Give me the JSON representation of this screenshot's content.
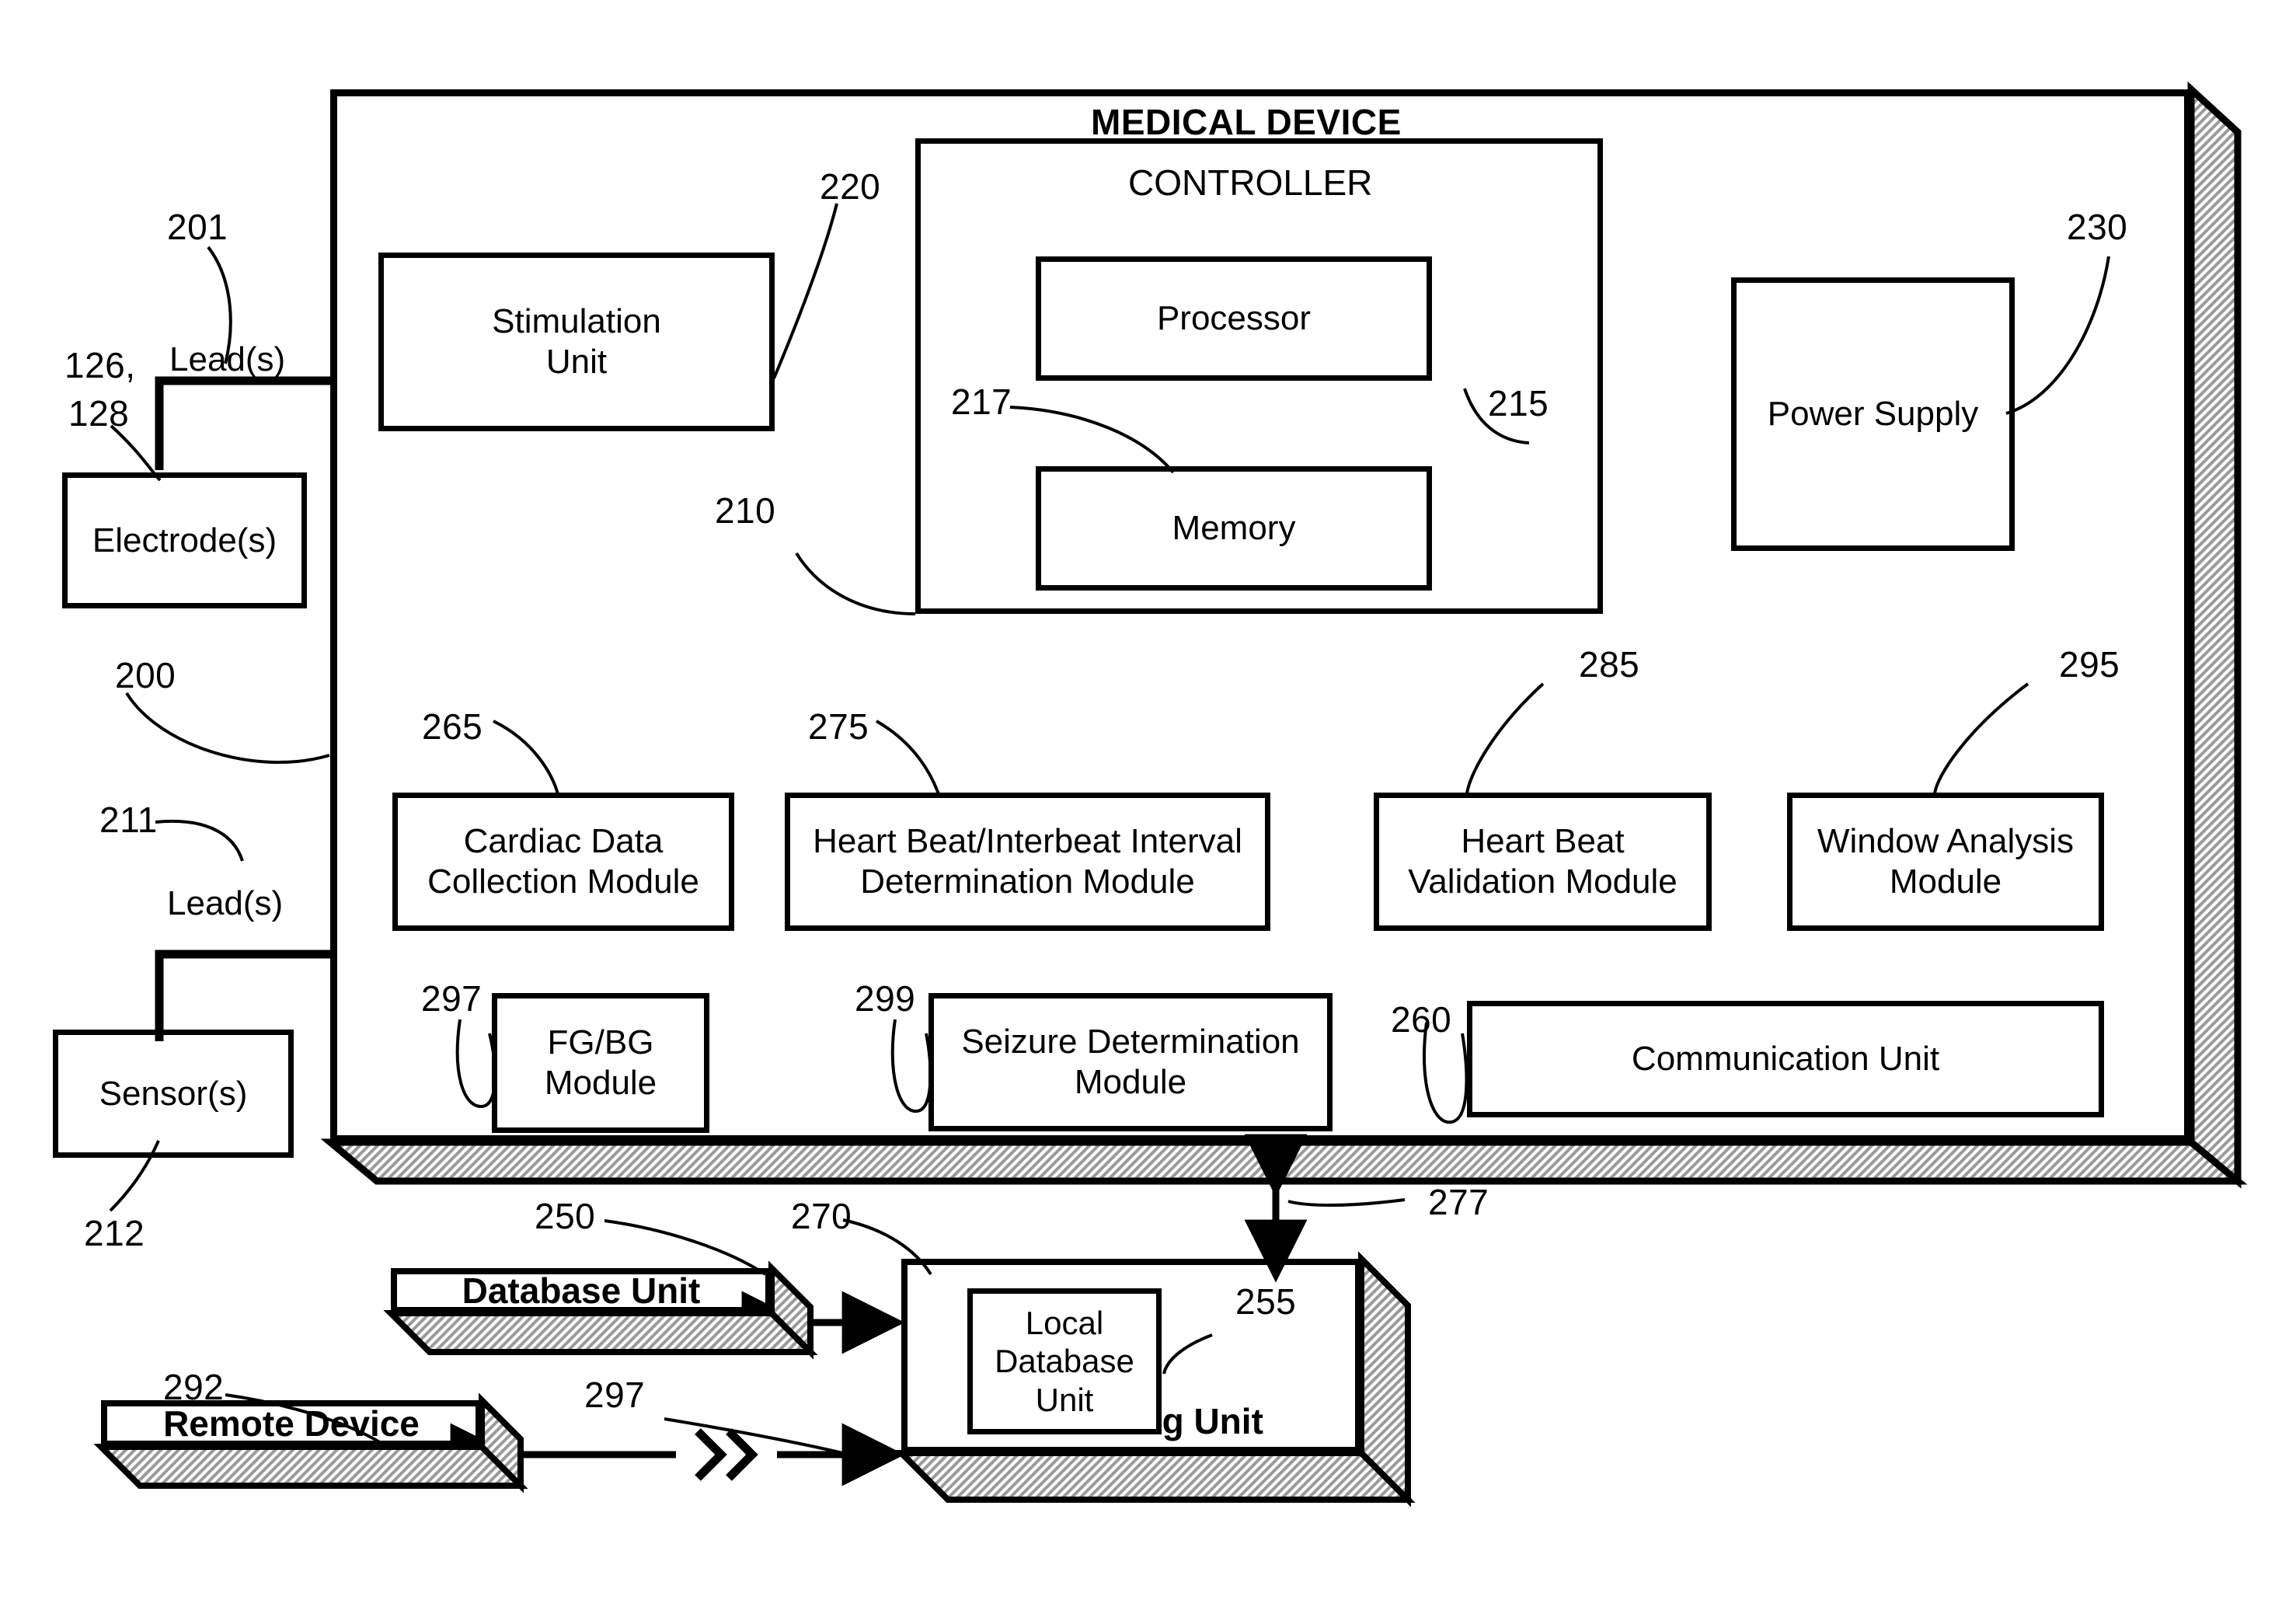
{
  "figure": {
    "device_title": "MEDICAL DEVICE",
    "controller_title": "CONTROLLER"
  },
  "blocks": {
    "electrodes": "Electrode(s)",
    "sensors": "Sensor(s)",
    "stimulation_unit": "Stimulation\nUnit",
    "stimulation_unit_line1": "Stimulation",
    "stimulation_unit_line2": "Unit",
    "processor": "Processor",
    "memory": "Memory",
    "power_supply": "Power Supply",
    "cardiac_data_collection_line1": "Cardiac Data",
    "cardiac_data_collection_line2": "Collection Module",
    "heartbeat_interbeat_line1": "Heart Beat/Interbeat Interval",
    "heartbeat_interbeat_line2": "Determination Module",
    "heartbeat_validation_line1": "Heart Beat",
    "heartbeat_validation_line2": "Validation Module",
    "window_analysis_line1": "Window Analysis",
    "window_analysis_line2": "Module",
    "fgbg_line1": "FG/BG",
    "fgbg_line2": "Module",
    "seizure_determination_line1": "Seizure Determination",
    "seizure_determination_line2": "Module",
    "communication_unit": "Communication Unit",
    "database_unit": "Database Unit",
    "remote_device": "Remote Device",
    "monitoring_unit": "Monitoring Unit",
    "local_database_line1": "Local",
    "local_database_line2": "Database",
    "local_database_line3": "Unit"
  },
  "labels": {
    "lead_top": "Lead(s)",
    "lead_bottom": "Lead(s)"
  },
  "refs": {
    "r126_128_line1": "126,",
    "r126_128_line2": "128",
    "r200": "200",
    "r201": "201",
    "r210": "210",
    "r211": "211",
    "r212": "212",
    "r215": "215",
    "r217": "217",
    "r220": "220",
    "r230": "230",
    "r250": "250",
    "r255": "255",
    "r260": "260",
    "r265": "265",
    "r270": "270",
    "r275": "275",
    "r277": "277",
    "r285": "285",
    "r292": "292",
    "r295": "295",
    "r297_module": "297",
    "r297_link": "297",
    "r299": "299"
  },
  "colors": {
    "stroke": "#000000",
    "background": "#ffffff",
    "shadow_hatch": "#a8a8a8"
  },
  "icons": {
    "wireless_break": "wireless-break-chevrons-icon",
    "arrow_double": "double-arrow-icon"
  }
}
